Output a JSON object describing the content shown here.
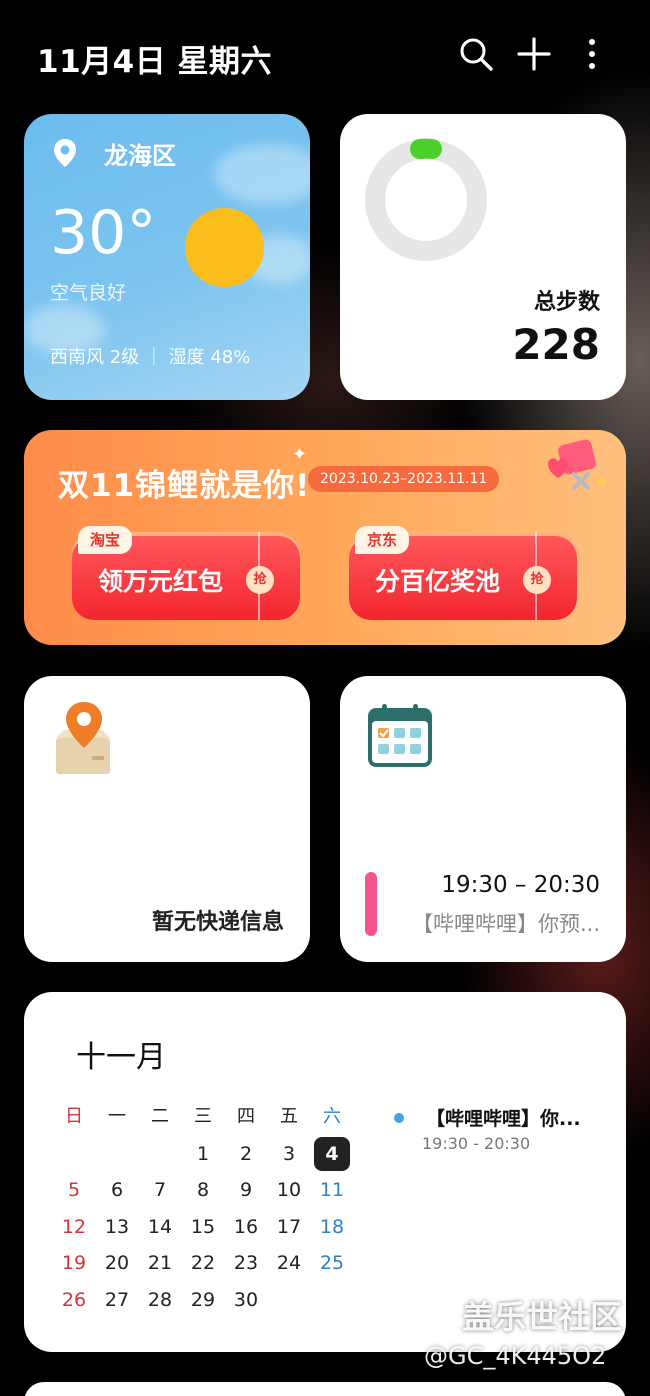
{
  "header": {
    "date": "11月4日 星期六"
  },
  "weather": {
    "location": "龙海区",
    "temperature": "30°",
    "air_quality": "空气良好",
    "wind_humidity": "西南风 2级 ｜ 湿度 48%",
    "sun_color": "#fbbd1c"
  },
  "steps": {
    "label": "总步数",
    "value": "228",
    "ring_color": "#e6e6e6",
    "progress_color": "#4cd12a"
  },
  "banner": {
    "title": "双11锦鲤就是你!",
    "dates": "2023.10.23–2023.11.11",
    "buttons": [
      {
        "tag": "淘宝",
        "label": "领万元红包",
        "grab": "抢"
      },
      {
        "tag": "京东",
        "label": "分百亿奖池",
        "grab": "抢"
      }
    ]
  },
  "express": {
    "text": "暂无快递信息"
  },
  "schedule": {
    "time": "19:30 – 20:30",
    "title": "【哔哩哔哩】你预...",
    "accent": "#f5548f"
  },
  "calendar": {
    "month": "十一月",
    "weekdays": [
      "日",
      "一",
      "二",
      "三",
      "四",
      "五",
      "六"
    ],
    "weeks": [
      [
        "",
        "",
        "",
        "1",
        "2",
        "3",
        "4"
      ],
      [
        "5",
        "6",
        "7",
        "8",
        "9",
        "10",
        "11"
      ],
      [
        "12",
        "13",
        "14",
        "15",
        "16",
        "17",
        "18"
      ],
      [
        "19",
        "20",
        "21",
        "22",
        "23",
        "24",
        "25"
      ],
      [
        "26",
        "27",
        "28",
        "29",
        "30",
        "",
        ""
      ]
    ],
    "today": "4",
    "event": {
      "title": "【哔哩哔哩】你...",
      "time": "19:30 - 20:30"
    }
  },
  "watermark": {
    "line1": "盖乐世社区",
    "line2": "@GC_4K445O2"
  }
}
